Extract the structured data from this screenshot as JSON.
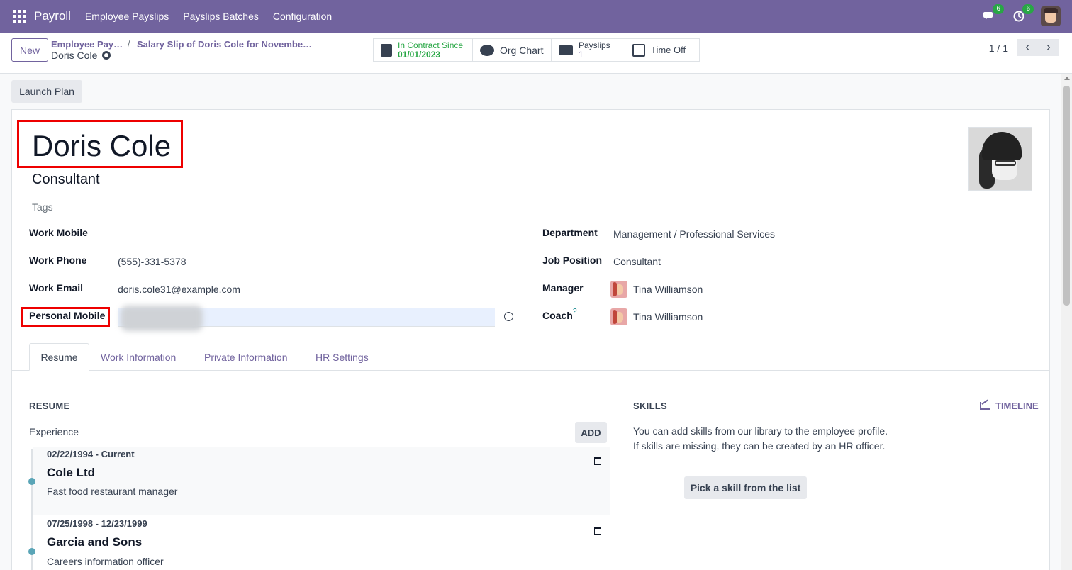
{
  "navbar": {
    "app_name": "Payroll",
    "menu": [
      "Employee Payslips",
      "Payslips Batches",
      "Configuration"
    ],
    "messages_badge": "6",
    "activities_badge": "6"
  },
  "control_panel": {
    "new_label": "New",
    "breadcrumb_1": "Employee Pay…",
    "breadcrumb_sep": "/",
    "breadcrumb_2": "Salary Slip of Doris Cole for Novembe…",
    "current_record": "Doris Cole",
    "smart_buttons": {
      "contract_label": "In Contract Since",
      "contract_value": "01/01/2023",
      "org_chart": "Org Chart",
      "payslips_label": "Payslips",
      "payslips_value": "1",
      "time_off": "Time Off"
    },
    "pager_value": "1 / 1"
  },
  "actions": {
    "launch_plan": "Launch Plan"
  },
  "employee": {
    "name": "Doris Cole",
    "job_title": "Consultant",
    "tags_placeholder": "Tags"
  },
  "fields_left": {
    "work_mobile_label": "Work Mobile",
    "work_mobile_value": "",
    "work_phone_label": "Work Phone",
    "work_phone_value": "(555)-331-5378",
    "work_email_label": "Work Email",
    "work_email_value": "doris.cole31@example.com",
    "personal_mobile_label": "Personal Mobile"
  },
  "fields_right": {
    "department_label": "Department",
    "department_value": "Management / Professional Services",
    "job_position_label": "Job Position",
    "job_position_value": "Consultant",
    "manager_label": "Manager",
    "manager_value": "Tina Williamson",
    "coach_label": "Coach",
    "coach_help": "?",
    "coach_value": "Tina Williamson"
  },
  "tabs": [
    "Resume",
    "Work Information",
    "Private Information",
    "HR Settings"
  ],
  "resume": {
    "title": "RESUME",
    "experience_label": "Experience",
    "add_label": "ADD",
    "entries": [
      {
        "dates": "02/22/1994 - Current",
        "company": "Cole Ltd",
        "description": "Fast food restaurant manager"
      },
      {
        "dates": "07/25/1998 - 12/23/1999",
        "company": "Garcia and Sons",
        "description": "Careers information officer"
      }
    ]
  },
  "skills": {
    "title": "SKILLS",
    "timeline_label": "TIMELINE",
    "line_1": "You can add skills from our library to the employee profile.",
    "line_2": "If skills are missing, they can be created by an HR officer.",
    "pick_label": "Pick a skill from the list"
  },
  "colors": {
    "brand": "#71639e",
    "highlight": "#ee0000",
    "success": "#28a745"
  }
}
